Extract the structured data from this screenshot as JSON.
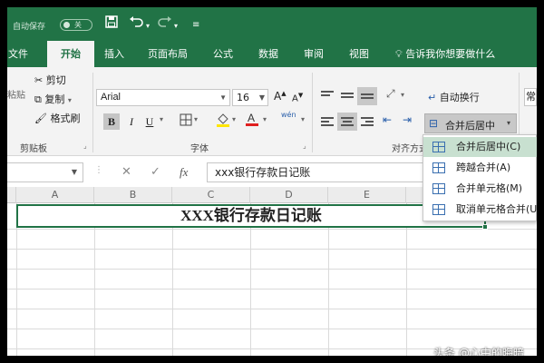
{
  "titlebar": {
    "autosave_label": "自动保存",
    "autosave_state": "关",
    "icons": [
      "save-icon",
      "undo-icon",
      "redo-icon",
      "customize-qat-icon"
    ]
  },
  "tabs": [
    {
      "label": "文件"
    },
    {
      "label": "开始",
      "active": true
    },
    {
      "label": "插入"
    },
    {
      "label": "页面布局"
    },
    {
      "label": "公式"
    },
    {
      "label": "数据"
    },
    {
      "label": "审阅"
    },
    {
      "label": "视图"
    }
  ],
  "tell_me": "告诉我你想要做什么",
  "clipboard": {
    "paste": "粘贴",
    "cut": "剪切",
    "copy": "复制",
    "format_painter": "格式刷",
    "group_label": "剪贴板"
  },
  "font": {
    "name": "Arial",
    "size": "16",
    "bold": "B",
    "italic": "I",
    "underline": "U",
    "group_label": "字体",
    "phonetic": "wén"
  },
  "alignment": {
    "wrap_text": "自动换行",
    "merge_center": "合并后居中",
    "group_label": "对齐方式",
    "normal_style": "常"
  },
  "formula_bar": {
    "cancel": "✕",
    "enter": "✓",
    "fx": "fx",
    "value": "xxx银行存款日记账"
  },
  "grid": {
    "columns": [
      "A",
      "B",
      "C",
      "D",
      "E"
    ],
    "merged_cell_text": "XXX银行存款日记账"
  },
  "merge_menu": [
    {
      "label": "合并后居中(C)",
      "highlighted": true
    },
    {
      "label": "跨越合并(A)"
    },
    {
      "label": "合并单元格(M)"
    },
    {
      "label": "取消单元格合并(U)"
    }
  ],
  "watermark": "头条 @心中的晦暗",
  "colors": {
    "excel_green": "#217346",
    "ribbon_bg": "#f3f3f3",
    "menu_highlight": "#c8e0d0"
  }
}
